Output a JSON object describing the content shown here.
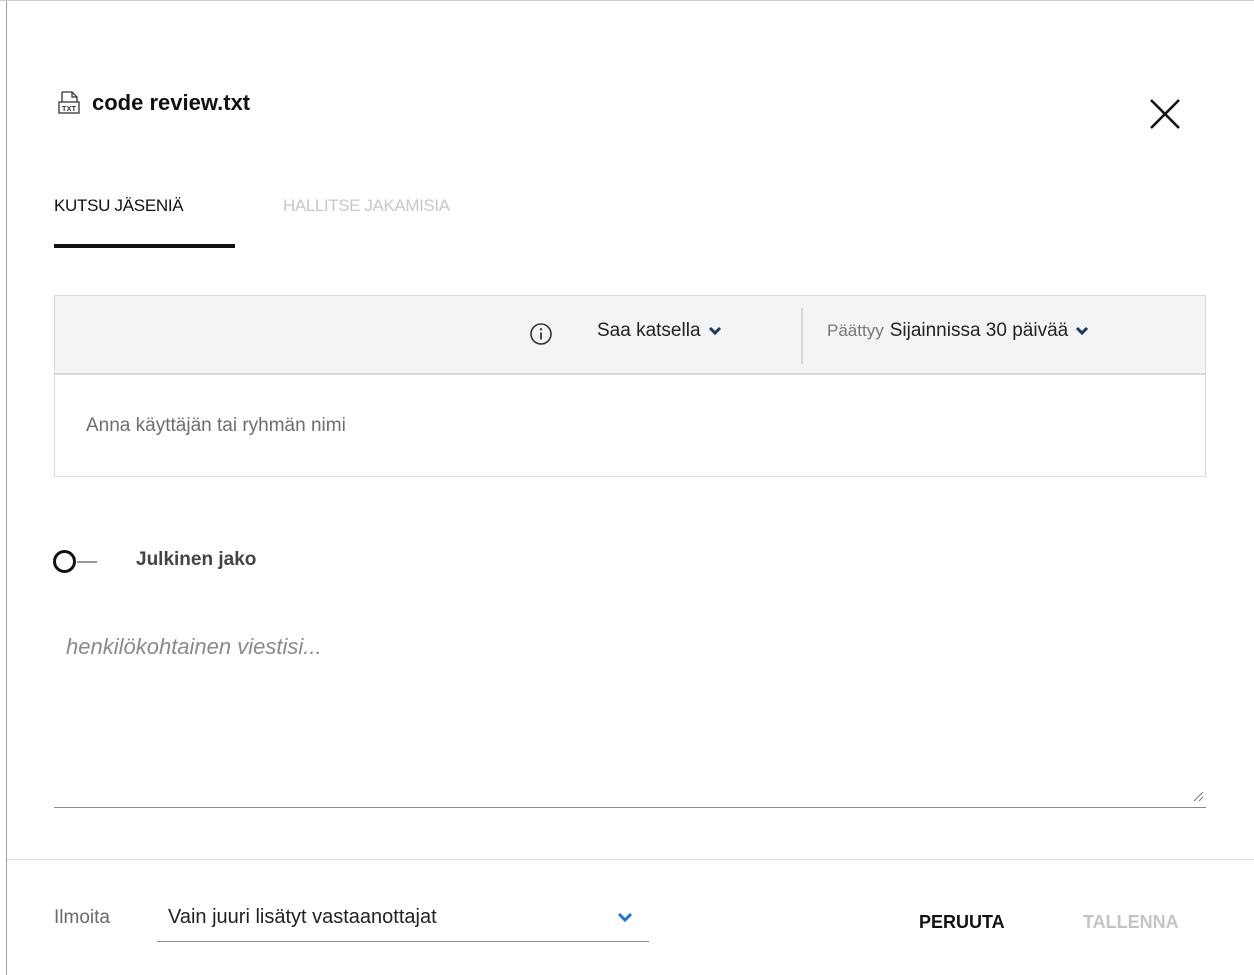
{
  "dialog": {
    "title": "code review.txt",
    "file_icon": "txt-file-icon",
    "close_icon": "close-icon"
  },
  "tabs": [
    {
      "label": "KUTSU JÄSENIÄ",
      "active": true
    },
    {
      "label": "HALLITSE JAKAMISIA",
      "active": false
    }
  ],
  "invite": {
    "permission": "Saa katsella",
    "expiry_label": "Päättyy",
    "expiry_value": "Sijainnissa 30 päivää",
    "user_placeholder": "Anna käyttäjän tai ryhmän nimi"
  },
  "public_share": {
    "label": "Julkinen jako",
    "enabled": false
  },
  "message": {
    "placeholder": "henkilökohtainen viestisi..."
  },
  "footer": {
    "notify_label": "Ilmoita",
    "notify_value": "Vain juuri lisätyt vastaanottajat",
    "cancel_label": "PERUUTA",
    "save_label": "TALLENNA"
  },
  "colors": {
    "accent": "#111111",
    "chevron": "#1b3a5c",
    "notify_chevron": "#1a73e8",
    "disabled": "#c4c4c4"
  }
}
